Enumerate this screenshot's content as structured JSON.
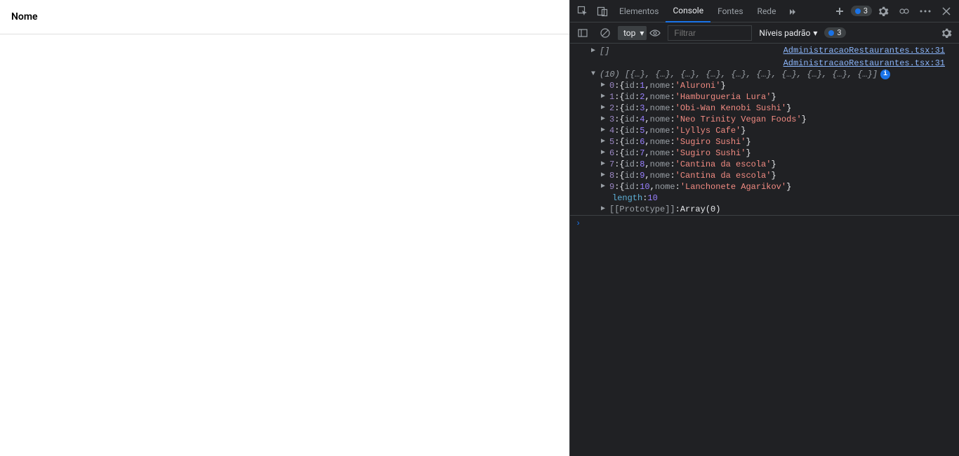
{
  "page": {
    "table_header": "Nome"
  },
  "devtools": {
    "tabs": {
      "elements": "Elementos",
      "console": "Console",
      "sources": "Fontes",
      "network": "Rede"
    },
    "active_tab": "Console",
    "issue_count": "3",
    "toolbar": {
      "context": "top",
      "filter_placeholder": "Filtrar",
      "levels_label": "Níveis padrão",
      "issue_count": "3"
    },
    "logs": {
      "source_link_1": "AdministracaoRestaurantes.tsx:31",
      "source_link_2": "AdministracaoRestaurantes.tsx:31",
      "array_empty": "[]",
      "array_count": "(10)",
      "array_preview": "[{…}, {…}, {…}, {…}, {…}, {…}, {…}, {…}, {…}, {…}]",
      "entries": [
        {
          "idx": "0",
          "id": "1",
          "nome": "Aluroni"
        },
        {
          "idx": "1",
          "id": "2",
          "nome": "Hamburgueria Lura"
        },
        {
          "idx": "2",
          "id": "3",
          "nome": "Obi-Wan Kenobi Sushi"
        },
        {
          "idx": "3",
          "id": "4",
          "nome": "Neo Trinity Vegan Foods"
        },
        {
          "idx": "4",
          "id": "5",
          "nome": "Lyllys Cafe"
        },
        {
          "idx": "5",
          "id": "6",
          "nome": "Sugiro Sushi"
        },
        {
          "idx": "6",
          "id": "7",
          "nome": "Sugiro Sushi"
        },
        {
          "idx": "7",
          "id": "8",
          "nome": "Cantina da escola"
        },
        {
          "idx": "8",
          "id": "9",
          "nome": "Cantina da escola"
        },
        {
          "idx": "9",
          "id": "10",
          "nome": "Lanchonete Agarikov"
        }
      ],
      "length_label": "length",
      "length_value": "10",
      "prototype_label": "[[Prototype]]",
      "prototype_value": "Array(0)"
    }
  }
}
